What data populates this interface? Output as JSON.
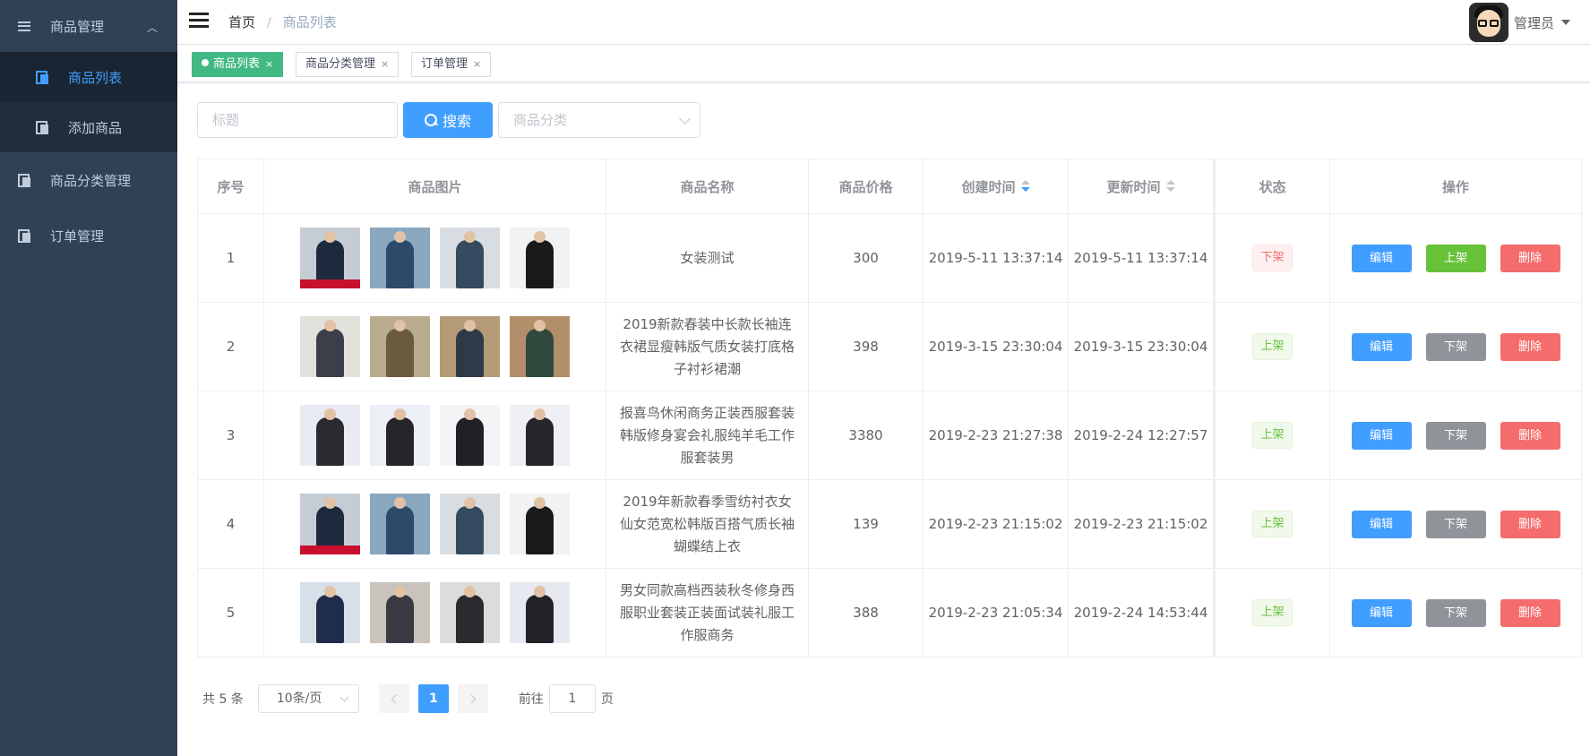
{
  "sidebar": {
    "groups": [
      {
        "label": "商品管理",
        "icon": "list-icon",
        "expanded": true,
        "children": [
          {
            "label": "商品列表",
            "icon": "doc-icon",
            "active": true
          },
          {
            "label": "添加商品",
            "icon": "doc-icon",
            "active": false
          }
        ]
      },
      {
        "label": "商品分类管理",
        "icon": "doc-icon"
      },
      {
        "label": "订单管理",
        "icon": "doc-icon"
      }
    ]
  },
  "header": {
    "breadcrumb": {
      "home": "首页",
      "separator": "/",
      "current": "商品列表"
    },
    "user": {
      "name": "管理员"
    }
  },
  "tags": [
    {
      "label": "商品列表",
      "active": true
    },
    {
      "label": "商品分类管理",
      "active": false
    },
    {
      "label": "订单管理",
      "active": false
    }
  ],
  "tag_close": "×",
  "filter": {
    "title_placeholder": "标题",
    "search_label": "搜索",
    "category_placeholder": "商品分类"
  },
  "table": {
    "columns": [
      "序号",
      "商品图片",
      "商品名称",
      "商品价格",
      "创建时间",
      "更新时间",
      "状态",
      "操作"
    ],
    "rows": [
      {
        "index": "1",
        "name": "女装测试",
        "price": "300",
        "created": "2019-5-11 13:37:14",
        "updated": "2019-5-11 13:37:14",
        "status": "下架",
        "toggle": "上架"
      },
      {
        "index": "2",
        "name": "2019新款春装中长款长袖连衣裙显瘦韩版气质女装打底格子衬衫裙潮",
        "price": "398",
        "created": "2019-3-15 23:30:04",
        "updated": "2019-3-15 23:30:04",
        "status": "上架",
        "toggle": "下架"
      },
      {
        "index": "3",
        "name": "报喜鸟休闲商务正装西服套装韩版修身宴会礼服纯羊毛工作服套装男",
        "price": "3380",
        "created": "2019-2-23 21:27:38",
        "updated": "2019-2-24 12:27:57",
        "status": "上架",
        "toggle": "下架"
      },
      {
        "index": "4",
        "name": "2019年新款春季雪纺衬衣女仙女范宽松韩版百搭气质长袖蝴蝶结上衣",
        "price": "139",
        "created": "2019-2-23 21:15:02",
        "updated": "2019-2-23 21:15:02",
        "status": "上架",
        "toggle": "下架"
      },
      {
        "index": "5",
        "name": "男女同款高档西装秋冬修身西服职业套装正装面试装礼服工作服商务",
        "price": "388",
        "created": "2019-2-23 21:05:34",
        "updated": "2019-2-24 14:53:44",
        "status": "上架",
        "toggle": "下架"
      }
    ],
    "edit_label": "编辑",
    "delete_label": "删除"
  },
  "pagination": {
    "total": "共 5 条",
    "page_size": "10条/页",
    "current_page": "1",
    "goto_prefix": "前往",
    "goto_value": "1",
    "goto_suffix": "页"
  },
  "colors": {
    "sidebar_bg": "#304156",
    "primary": "#409eff",
    "success": "#67c23a",
    "danger": "#f56c6c",
    "info": "#909399",
    "tag_active": "#42b983"
  }
}
